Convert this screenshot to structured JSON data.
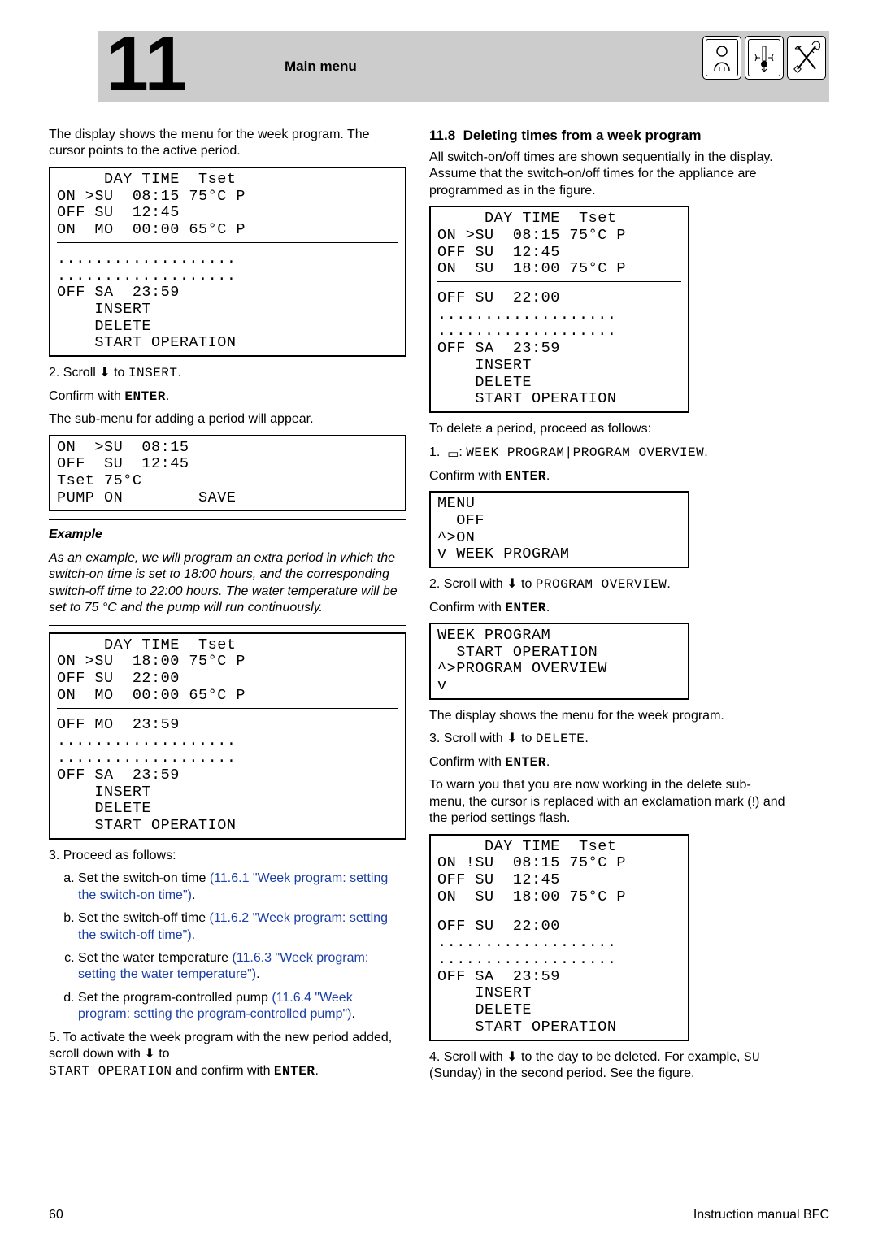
{
  "header": {
    "chapter_number": "11",
    "title": "Main menu"
  },
  "left": {
    "intro": "The display shows the menu for the week program. The cursor points to the active period.",
    "lcd1": "     DAY TIME  Tset\nON >SU  08:15 75°C P\nOFF SU  12:45\nON  MO  00:00 65°C P\n───────────────────\n...................\n...................\nOFF SA  23:59\n    INSERT\n    DELETE\n    START OPERATION",
    "step2_a": "2.  Scroll ",
    "step2_b": " to ",
    "step2_insert": "INSERT",
    "step2_c": ".",
    "confirm_a": "Confirm with ",
    "confirm_enter": "ENTER",
    "subp": "The sub-menu for adding a period will appear.",
    "lcd2": "ON  >SU  08:15\nOFF  SU  12:45\nTset 75°C\nPUMP ON        SAVE",
    "example_lbl": "Example",
    "example_body": "As an example, we will program an extra period in which the switch-on time is set to 18:00 hours, and the corresponding switch-off time to 22:00 hours. The water temperature will be set to 75 °C and the pump will run continuously.",
    "lcd3": "     DAY TIME  Tset\nON >SU  18:00 75°C P\nOFF SU  22:00\nON  MO  00:00 65°C P\n───────────────────\nOFF MO  23:59\n...................\n...................\nOFF SA  23:59\n    INSERT\n    DELETE\n    START OPERATION",
    "step3_lbl": "3.  Proceed as follows:",
    "sub_a_1": "Set the switch-on time ",
    "sub_a_link": "(11.6.1 \"Week program: setting the switch-on time\")",
    "sub_b_1": "Set the switch-off time ",
    "sub_b_link": "(11.6.2 \"Week program: setting the switch-off time\")",
    "sub_c_1": "Set the water temperature ",
    "sub_c_link": "(11.6.3 \"Week program: setting the water temperature\")",
    "sub_d_1": "Set the program-controlled pump ",
    "sub_d_link": "(11.6.4 \"Week program: setting the program-controlled pump\")",
    "step5_a": "5.  To activate the week program with the new period added, scroll down with ",
    "step5_b": " to ",
    "step5_so": "START OPERATION",
    "step5_c": " and confirm with ",
    "step5_enter": "ENTER"
  },
  "right": {
    "sec_num": "11.8",
    "sec_title": "Deleting times from a week program",
    "p1": "All switch-on/off times are shown sequentially in the display. Assume that the switch-on/off times for the appliance are programmed as in the figure.",
    "lcd1": "     DAY TIME  Tset\nON >SU  08:15 75°C P\nOFF SU  12:45\nON  SU  18:00 75°C P\n───────────────────\nOFF SU  22:00\n...................\n...................\nOFF SA  23:59\n    INSERT\n    DELETE\n    START OPERATION",
    "todel": "To delete a period, proceed as follows:",
    "step1_b": ": ",
    "step1_m": "WEEK PROGRAM|PROGRAM OVERVIEW",
    "lcd2": "MENU\n  OFF\n^>ON\nv WEEK PROGRAM",
    "step2_a": "2.  Scroll with ",
    "step2_b": " to ",
    "step2_m": "PROGRAM OVERVIEW",
    "lcd3": "WEEK PROGRAM\n  START OPERATION\n^>PROGRAM OVERVIEW\nv",
    "p2": "The display shows the menu for the week program.",
    "step3_a": "3.  Scroll with ",
    "step3_b": " to ",
    "step3_m": "DELETE",
    "warn": "To warn you that you are now working in the delete sub-menu, the cursor is replaced with an exclamation mark (!) and the period settings flash.",
    "lcd4": "     DAY TIME  Tset\nON !SU  08:15 75°C P\nOFF SU  12:45\nON  SU  18:00 75°C P\n───────────────────\nOFF SU  22:00\n...................\n...................\nOFF SA  23:59\n    INSERT\n    DELETE\n    START OPERATION",
    "step4_a": "4.  Scroll with ",
    "step4_b": " to the day to be deleted. For example, ",
    "step4_su": "SU",
    "step4_c": " (Sunday) in the second period. See the figure."
  },
  "footer": {
    "page": "60",
    "right": "Instruction manual BFC"
  }
}
